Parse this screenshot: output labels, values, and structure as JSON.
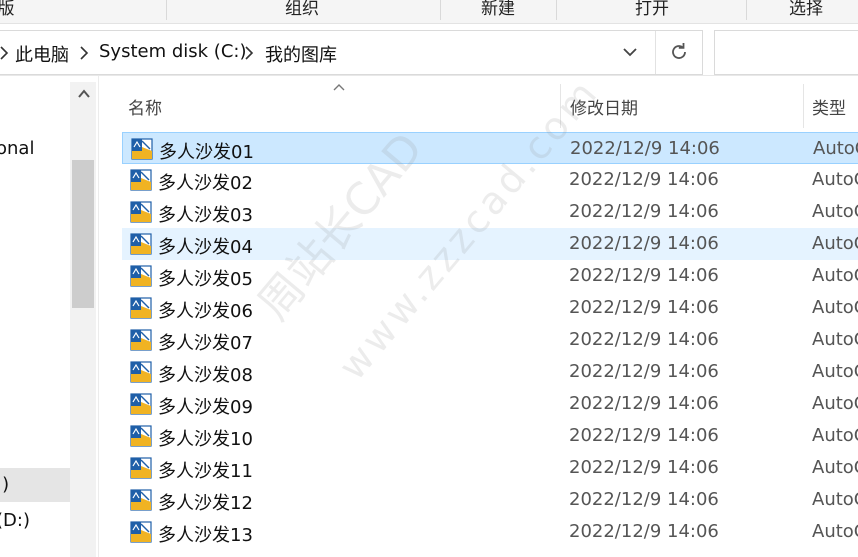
{
  "ribbon": {
    "groups": [
      "版",
      "组织",
      "新建",
      "打开",
      "选择"
    ]
  },
  "address": {
    "crumbs": [
      "此电脑",
      "System disk (C:)",
      "我的图库"
    ]
  },
  "nav": {
    "items": [
      "onal",
      ":)",
      "(D:)"
    ]
  },
  "columns": {
    "name": "名称",
    "date": "修改日期",
    "type": "类型"
  },
  "files": [
    {
      "name": "多人沙发01",
      "date": "2022/12/9 14:06",
      "type": "AutoC"
    },
    {
      "name": "多人沙发02",
      "date": "2022/12/9 14:06",
      "type": "AutoC"
    },
    {
      "name": "多人沙发03",
      "date": "2022/12/9 14:06",
      "type": "AutoC"
    },
    {
      "name": "多人沙发04",
      "date": "2022/12/9 14:06",
      "type": "AutoC"
    },
    {
      "name": "多人沙发05",
      "date": "2022/12/9 14:06",
      "type": "AutoC"
    },
    {
      "name": "多人沙发06",
      "date": "2022/12/9 14:06",
      "type": "AutoC"
    },
    {
      "name": "多人沙发07",
      "date": "2022/12/9 14:06",
      "type": "AutoC"
    },
    {
      "name": "多人沙发08",
      "date": "2022/12/9 14:06",
      "type": "AutoC"
    },
    {
      "name": "多人沙发09",
      "date": "2022/12/9 14:06",
      "type": "AutoC"
    },
    {
      "name": "多人沙发10",
      "date": "2022/12/9 14:06",
      "type": "AutoC"
    },
    {
      "name": "多人沙发11",
      "date": "2022/12/9 14:06",
      "type": "AutoC"
    },
    {
      "name": "多人沙发12",
      "date": "2022/12/9 14:06",
      "type": "AutoC"
    },
    {
      "name": "多人沙发13",
      "date": "2022/12/9 14:06",
      "type": "AutoC"
    }
  ],
  "watermark": {
    "line1": "周站长CAD",
    "line2": "www.zzzcad.com"
  },
  "colors": {
    "selected_row": "#cce8ff",
    "hover_row": "#e5f3ff",
    "file_icon_blue": "#1f5fa8",
    "file_icon_yellow": "#f0b323"
  },
  "icons": {
    "file": "autocad-drawing-icon",
    "dropdown": "chevron-down-icon",
    "refresh": "refresh-icon",
    "breadcrumb_separator": "chevron-right-icon",
    "scroll_up": "chevron-up-icon",
    "sort": "sort-ascending-icon"
  }
}
